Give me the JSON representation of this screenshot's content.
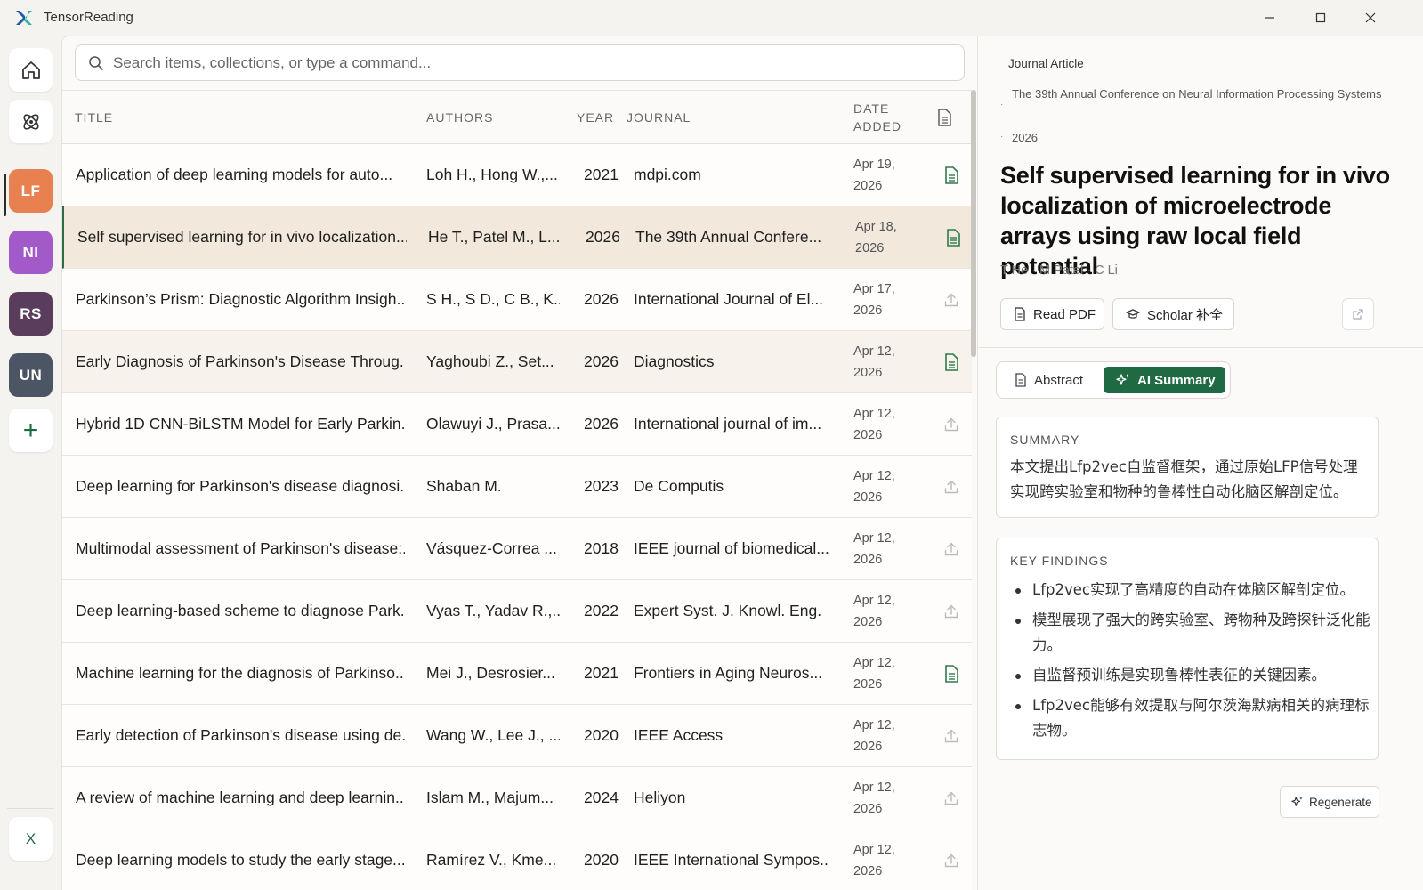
{
  "window": {
    "app_title": "TensorReading",
    "minimize": "—",
    "maximize": "☐",
    "close": "✕"
  },
  "rail": {
    "avatars": [
      {
        "label": "LF",
        "color": "#e8804f"
      },
      {
        "label": "NI",
        "color": "#a15ac7"
      },
      {
        "label": "RS",
        "color": "#5a3d5c"
      },
      {
        "label": "UN",
        "color": "#4b5563"
      }
    ],
    "add_label": "+",
    "bottom_label": "X"
  },
  "search": {
    "placeholder": "Search items, collections, or type a command..."
  },
  "table": {
    "headers": {
      "title": "TITLE",
      "authors": "AUTHORS",
      "year": "YEAR",
      "journal": "JOURNAL",
      "date_added_1": "DATE",
      "date_added_2": "ADDED"
    },
    "rows": [
      {
        "title": "Application of deep learning models for auto...",
        "authors": "Loh H., Hong W.,...",
        "year": "2021",
        "journal": "mdpi.com",
        "date1": "Apr 19,",
        "date2": "2026",
        "pdf": true
      },
      {
        "title": "Self supervised learning for in vivo localization...",
        "authors": "He T., Patel M., L...",
        "year": "2026",
        "journal": "The 39th Annual Confere...",
        "date1": "Apr 18,",
        "date2": "2026",
        "pdf": true
      },
      {
        "title": "Parkinson’s Prism: Diagnostic Algorithm Insigh...",
        "authors": "S H., S D., C B., K...",
        "year": "2026",
        "journal": "International Journal of El...",
        "date1": "Apr 17,",
        "date2": "2026",
        "pdf": false
      },
      {
        "title": "Early Diagnosis of Parkinson's Disease Throug...",
        "authors": "Yaghoubi Z., Set...",
        "year": "2026",
        "journal": "Diagnostics",
        "date1": "Apr 12,",
        "date2": "2026",
        "pdf": true
      },
      {
        "title": "Hybrid 1D CNN-BiLSTM Model for Early Parkin...",
        "authors": "Olawuyi J., Prasa...",
        "year": "2026",
        "journal": "International journal of im...",
        "date1": "Apr 12,",
        "date2": "2026",
        "pdf": false
      },
      {
        "title": "Deep learning for Parkinson's disease diagnosi...",
        "authors": "Shaban M.",
        "year": "2023",
        "journal": "De Computis",
        "date1": "Apr 12,",
        "date2": "2026",
        "pdf": false
      },
      {
        "title": "Multimodal assessment of Parkinson's disease:...",
        "authors": "Vásquez-Correa ...",
        "year": "2018",
        "journal": "IEEE journal of biomedical...",
        "date1": "Apr 12,",
        "date2": "2026",
        "pdf": false
      },
      {
        "title": "Deep learning-based scheme to diagnose Park...",
        "authors": "Vyas T., Yadav R.,...",
        "year": "2022",
        "journal": "Expert Syst. J. Knowl. Eng.",
        "date1": "Apr 12,",
        "date2": "2026",
        "pdf": false
      },
      {
        "title": "Machine learning for the diagnosis of Parkinso...",
        "authors": "Mei J., Desrosier...",
        "year": "2021",
        "journal": "Frontiers in Aging Neuros...",
        "date1": "Apr 12,",
        "date2": "2026",
        "pdf": true
      },
      {
        "title": "Early detection of Parkinson's disease using de...",
        "authors": "Wang W., Lee J., ...",
        "year": "2020",
        "journal": "IEEE Access",
        "date1": "Apr 12,",
        "date2": "2026",
        "pdf": false
      },
      {
        "title": "A review of machine learning and deep learnin...",
        "authors": "Islam M., Majum...",
        "year": "2024",
        "journal": "Heliyon",
        "date1": "Apr 12,",
        "date2": "2026",
        "pdf": false
      },
      {
        "title": "Deep learning models to study the early stage...",
        "authors": "Ramírez V., Kme...",
        "year": "2020",
        "journal": "IEEE International Sympos...",
        "date1": "Apr 12,",
        "date2": "2026",
        "pdf": false
      }
    ]
  },
  "details": {
    "item_type": "Journal Article",
    "venue": "The 39th Annual Conference on Neural Information Processing Systems",
    "year": "2026",
    "title": "Self supervised learning for in vivo localization of microelectrode arrays using raw local field potential",
    "authors": "T He · M Patel · C Li",
    "read_pdf": "Read PDF",
    "scholar": "Scholar 补全",
    "tabs": {
      "abstract": "Abstract",
      "ai_summary": "AI Summary"
    },
    "summary_heading": "SUMMARY",
    "summary_text": "本文提出Lfp2vec自监督框架，通过原始LFP信号处理实现跨实验室和物种的鲁棒性自动化脑区解剖定位。",
    "findings_heading": "KEY FINDINGS",
    "findings": [
      "Lfp2vec实现了高精度的自动在体脑区解剖定位。",
      "模型展现了强大的跨实验室、跨物种及跨探针泛化能力。",
      "自监督预训练是实现鲁棒性表征的关键因素。",
      "Lfp2vec能够有效提取与阿尔茨海默病相关的病理标志物。"
    ],
    "regenerate": "Regenerate"
  },
  "colors": {
    "accent_green": "#1f6a42",
    "pdf_icon_green": "#2f7a4f",
    "selected_row": "#f2e8dc"
  }
}
